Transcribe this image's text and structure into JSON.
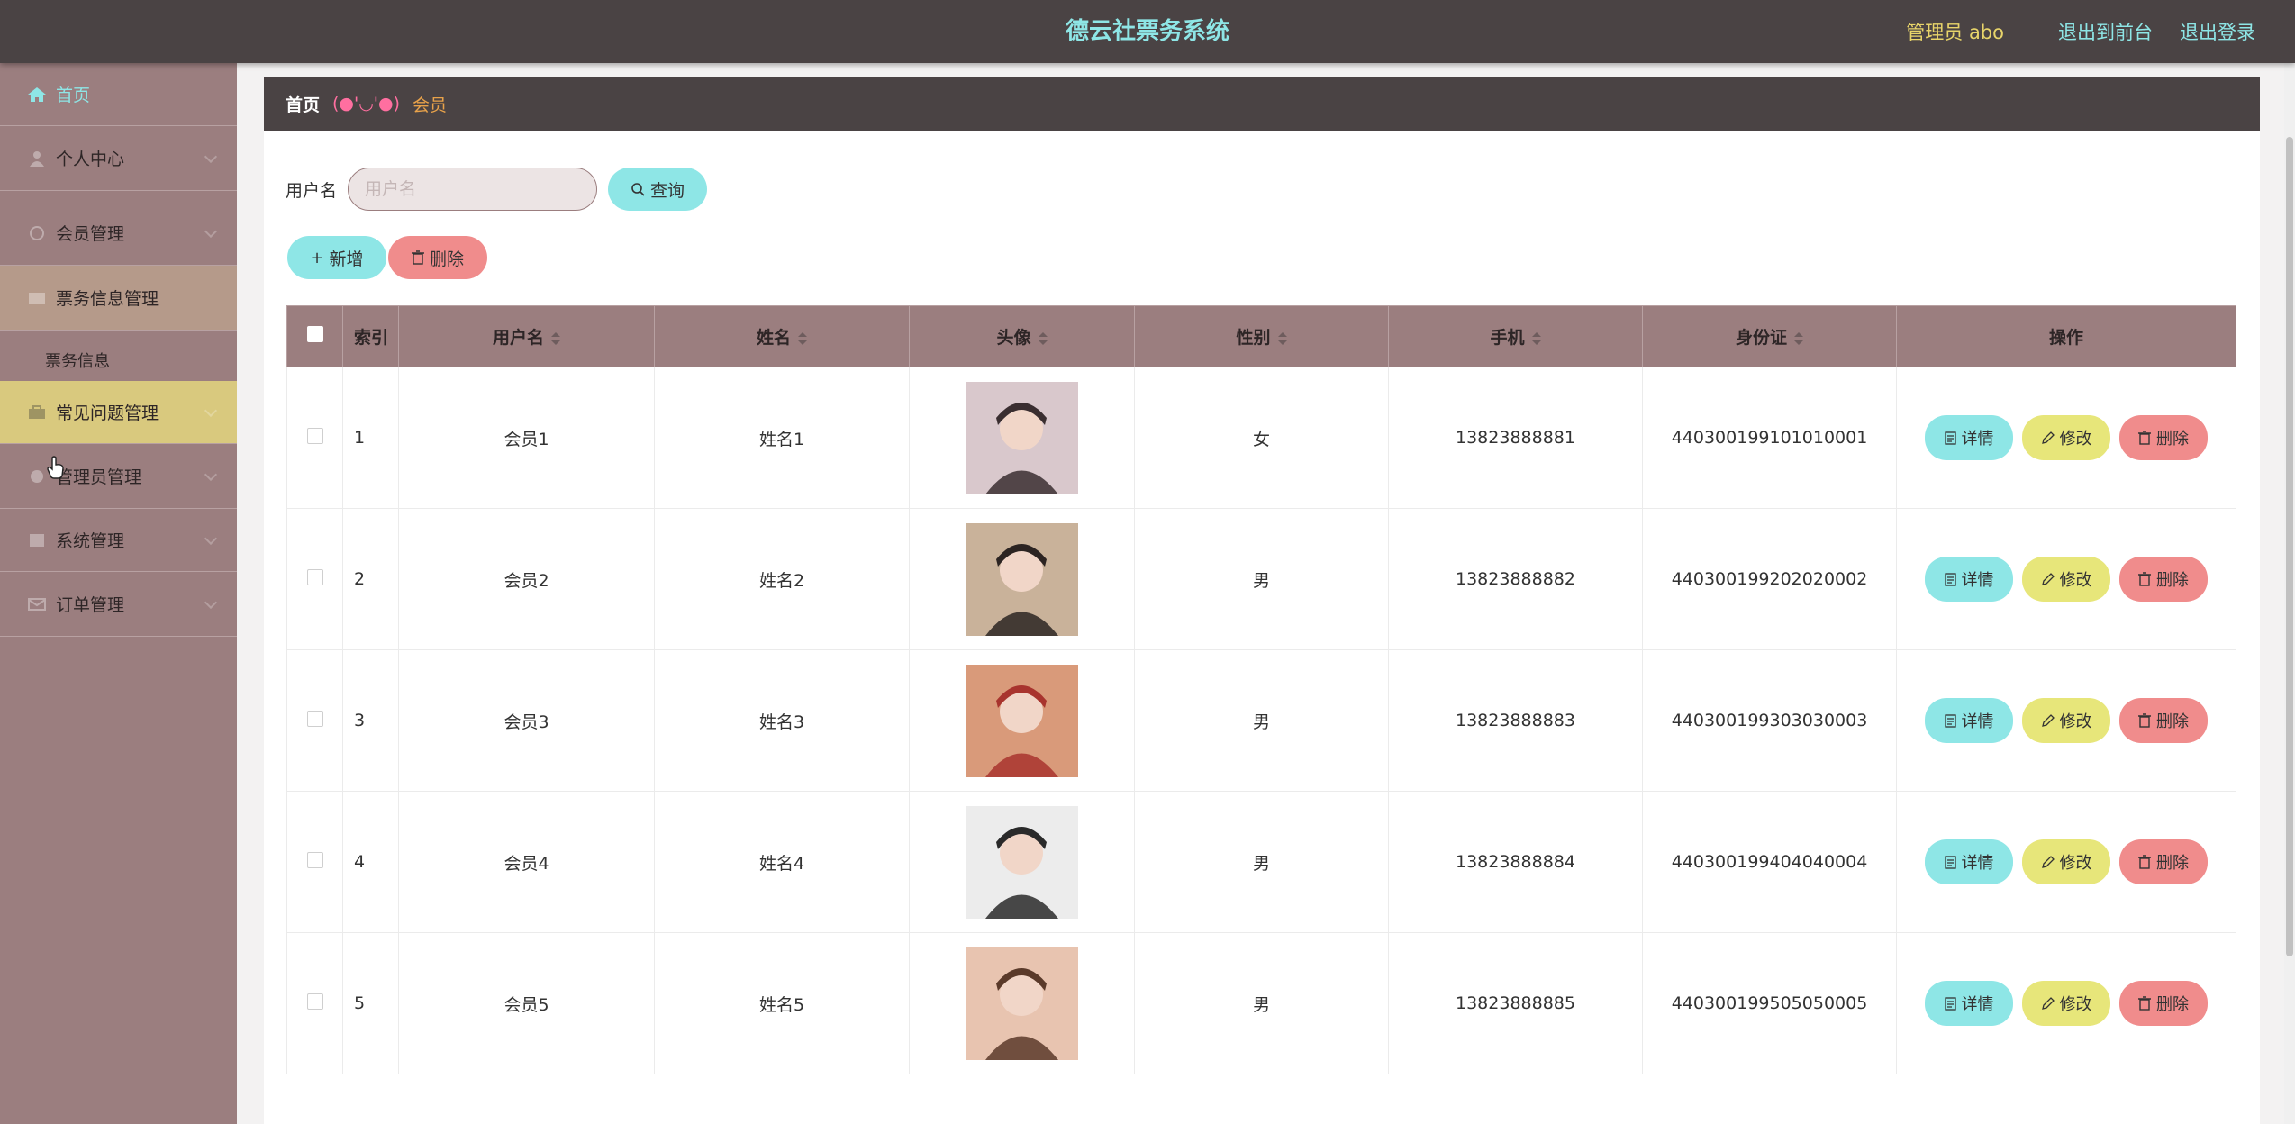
{
  "header": {
    "title": "德云社票务系统",
    "admin_label": "管理员 abo",
    "links": [
      "退出到前台",
      "退出登录"
    ]
  },
  "sidebar": {
    "items": [
      {
        "label": "首页",
        "icon": "home-icon"
      },
      {
        "label": "个人中心",
        "icon": "user-icon"
      },
      {
        "label": "会员管理",
        "icon": "member-icon"
      },
      {
        "label": "票务信息管理",
        "icon": "ticket-icon"
      },
      {
        "label": "票务信息",
        "icon": ""
      },
      {
        "label": "常见问题管理",
        "icon": "faq-icon"
      },
      {
        "label": "管理员管理",
        "icon": "admin-icon"
      },
      {
        "label": "系统管理",
        "icon": "system-icon"
      },
      {
        "label": "订单管理",
        "icon": "order-icon"
      }
    ]
  },
  "breadcrumb": {
    "home": "首页",
    "separator": "(●'◡'●)",
    "current": "会员"
  },
  "search": {
    "label": "用户名",
    "placeholder": "用户名",
    "value": "",
    "button": "查询"
  },
  "actions": {
    "add": "新增",
    "delete": "删除"
  },
  "table": {
    "columns": [
      "索引",
      "用户名",
      "姓名",
      "头像",
      "性别",
      "手机",
      "身份证",
      "操作"
    ],
    "rows": [
      {
        "index": "1",
        "username": "会员1",
        "name": "姓名1",
        "gender": "女",
        "phone": "13823888881",
        "id_card": "440300199101010001"
      },
      {
        "index": "2",
        "username": "会员2",
        "name": "姓名2",
        "gender": "男",
        "phone": "13823888882",
        "id_card": "440300199202020002"
      },
      {
        "index": "3",
        "username": "会员3",
        "name": "姓名3",
        "gender": "男",
        "phone": "13823888883",
        "id_card": "440300199303030003"
      },
      {
        "index": "4",
        "username": "会员4",
        "name": "姓名4",
        "gender": "男",
        "phone": "13823888884",
        "id_card": "440300199404040004"
      },
      {
        "index": "5",
        "username": "会员5",
        "name": "姓名5",
        "gender": "男",
        "phone": "13823888885",
        "id_card": "440300199505050005"
      }
    ],
    "row_actions": {
      "detail": "详情",
      "edit": "修改",
      "delete": "删除"
    }
  },
  "colors": {
    "topbar": "#4a4344",
    "sidebar": "#9b7e7f",
    "accent_cyan": "#8ee6e6",
    "accent_red": "#f08c8c",
    "accent_yellow": "#e7e67a"
  }
}
